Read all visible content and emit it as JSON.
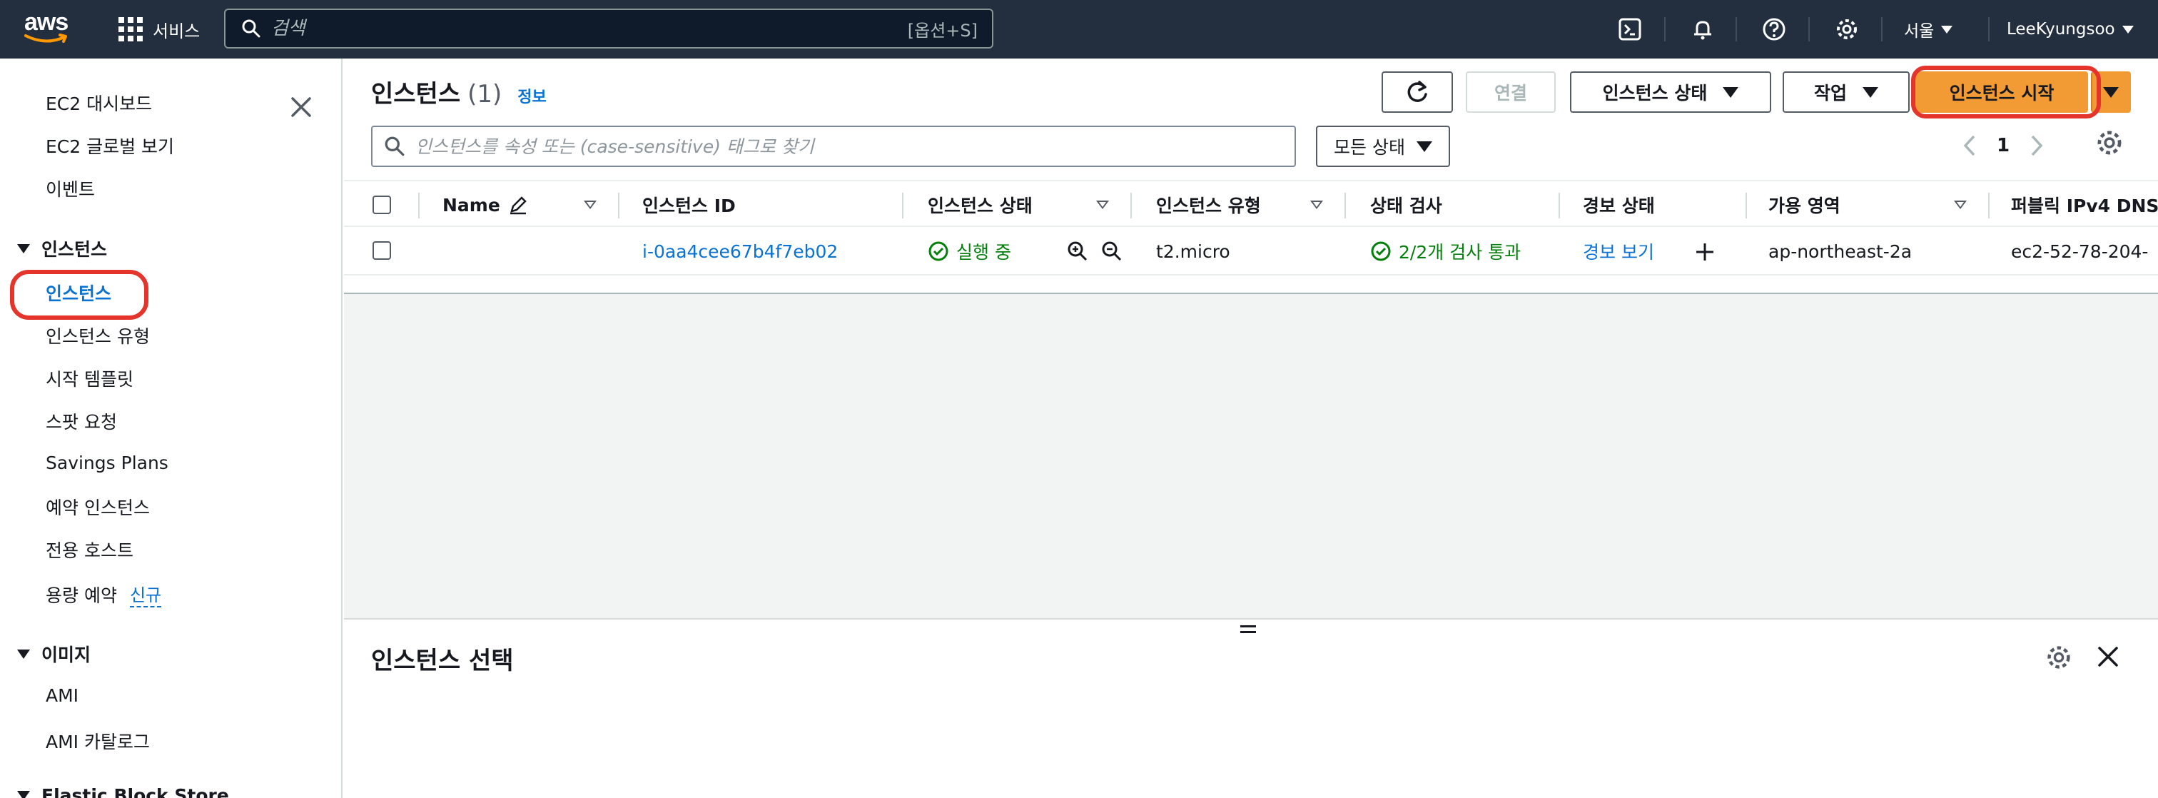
{
  "topnav": {
    "logo_text": "aws",
    "services_label": "서비스",
    "search_placeholder": "검색",
    "search_shortcut": "[옵션+S]",
    "region": "서울",
    "user": "LeeKyungsoo"
  },
  "sidebar": {
    "items_top": [
      "EC2 대시보드",
      "EC2 글로벌 보기",
      "이벤트"
    ],
    "section_instances": "인스턴스",
    "instance_items": [
      "인스턴스",
      "인스턴스 유형",
      "시작 템플릿",
      "스팟 요청",
      "Savings Plans",
      "예약 인스턴스",
      "전용 호스트",
      "용량 예약"
    ],
    "new_badge": "신규",
    "section_images": "이미지",
    "image_items": [
      "AMI",
      "AMI 카탈로그"
    ],
    "section_ebs": "Elastic Block Store"
  },
  "main": {
    "title": "인스턴스",
    "count": "(1)",
    "info": "정보",
    "buttons": {
      "connect": "연결",
      "instance_state": "인스턴스 상태",
      "actions": "작업",
      "launch": "인스턴스 시작"
    },
    "filter_placeholder": "인스턴스를 속성 또는 (case-sensitive) 태그로 찾기",
    "state_filter": "모든 상태",
    "page_number": "1",
    "columns": [
      "Name",
      "인스턴스 ID",
      "인스턴스 상태",
      "인스턴스 유형",
      "상태 검사",
      "경보 상태",
      "가용 영역",
      "퍼블릭 IPv4 DNS"
    ],
    "row": {
      "name": "",
      "instance_id": "i-0aa4cee67b4f7eb02",
      "state": "실행 중",
      "type": "t2.micro",
      "status_check": "2/2개 검사 통과",
      "alarm": "경보 보기",
      "az": "ap-northeast-2a",
      "public_dns": "ec2-52-78-204-"
    }
  },
  "details": {
    "title": "인스턴스 선택"
  },
  "colors": {
    "nav_bg": "#232f3e",
    "link": "#0972d3",
    "success": "#037f0c",
    "primary_button": "#f29b35",
    "highlight": "#e5342b"
  }
}
